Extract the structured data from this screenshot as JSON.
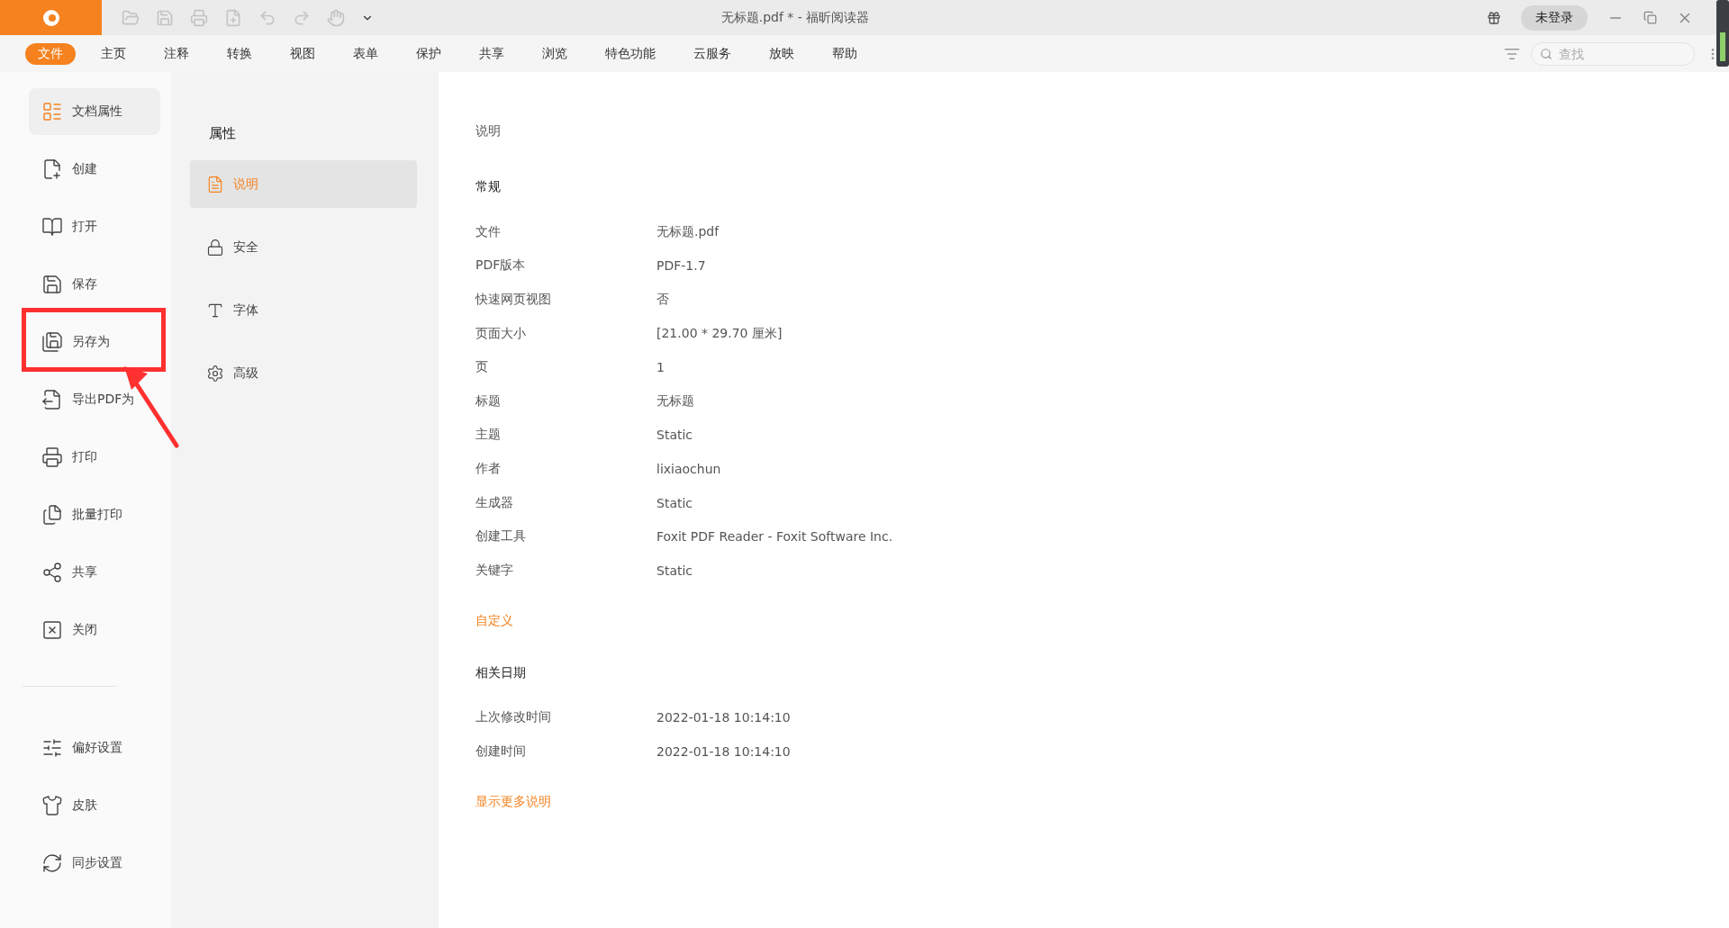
{
  "window": {
    "title": "无标题.pdf * - 福昕阅读器",
    "login_button": "未登录"
  },
  "menu": [
    {
      "label": "文件",
      "selected": true
    },
    {
      "label": "主页",
      "selected": false
    },
    {
      "label": "注释",
      "selected": false
    },
    {
      "label": "转换",
      "selected": false
    },
    {
      "label": "视图",
      "selected": false
    },
    {
      "label": "表单",
      "selected": false
    },
    {
      "label": "保护",
      "selected": false
    },
    {
      "label": "共享",
      "selected": false
    },
    {
      "label": "浏览",
      "selected": false
    },
    {
      "label": "特色功能",
      "selected": false
    },
    {
      "label": "云服务",
      "selected": false
    },
    {
      "label": "放映",
      "selected": false
    },
    {
      "label": "帮助",
      "selected": false
    }
  ],
  "search": {
    "placeholder": "查找"
  },
  "sidebar": {
    "items": [
      {
        "label": "文档属性",
        "kind": "properties",
        "selected": true,
        "annotated": false
      },
      {
        "label": "创建",
        "kind": "create",
        "selected": false,
        "annotated": false
      },
      {
        "label": "打开",
        "kind": "open",
        "selected": false,
        "annotated": false
      },
      {
        "label": "保存",
        "kind": "save",
        "selected": false,
        "annotated": false
      },
      {
        "label": "另存为",
        "kind": "save-as",
        "selected": false,
        "annotated": true
      },
      {
        "label": "导出PDF为",
        "kind": "export",
        "selected": false,
        "annotated": false
      },
      {
        "label": "打印",
        "kind": "print",
        "selected": false,
        "annotated": false
      },
      {
        "label": "批量打印",
        "kind": "batch-print",
        "selected": false,
        "annotated": false
      },
      {
        "label": "共享",
        "kind": "share",
        "selected": false,
        "annotated": false
      },
      {
        "label": "关闭",
        "kind": "close",
        "selected": false,
        "annotated": false
      }
    ],
    "bottom_items": [
      {
        "label": "偏好设置",
        "kind": "preferences",
        "selected": false,
        "annotated": false
      },
      {
        "label": "皮肤",
        "kind": "skin",
        "selected": false,
        "annotated": false
      },
      {
        "label": "同步设置",
        "kind": "sync",
        "selected": false,
        "annotated": false
      }
    ]
  },
  "properties_nav": {
    "title": "属性",
    "items": [
      {
        "label": "说明",
        "kind": "info",
        "selected": true
      },
      {
        "label": "安全",
        "kind": "security",
        "selected": false
      },
      {
        "label": "字体",
        "kind": "fonts",
        "selected": false
      },
      {
        "label": "高级",
        "kind": "advanced",
        "selected": false
      }
    ]
  },
  "details": {
    "heading": "说明",
    "general": {
      "title": "常规",
      "rows": [
        {
          "label": "文件",
          "value": "无标题.pdf"
        },
        {
          "label": "PDF版本",
          "value": "PDF-1.7"
        },
        {
          "label": "快速网页视图",
          "value": "否"
        },
        {
          "label": "页面大小",
          "value": "[21.00 * 29.70 厘米]"
        },
        {
          "label": "页",
          "value": "1"
        },
        {
          "label": "标题",
          "value": "无标题"
        },
        {
          "label": "主题",
          "value": "Static"
        },
        {
          "label": "作者",
          "value": "lixiaochun"
        },
        {
          "label": "生成器",
          "value": "Static"
        },
        {
          "label": "创建工具",
          "value": "Foxit PDF Reader - Foxit Software Inc."
        },
        {
          "label": "关键字",
          "value": "Static"
        }
      ]
    },
    "custom_link": "自定义",
    "dates": {
      "title": "相关日期",
      "rows": [
        {
          "label": "上次修改时间",
          "value": "2022-01-18 10:14:10"
        },
        {
          "label": "创建时间",
          "value": "2022-01-18 10:14:10"
        }
      ]
    },
    "more_link": "显示更多说明"
  }
}
